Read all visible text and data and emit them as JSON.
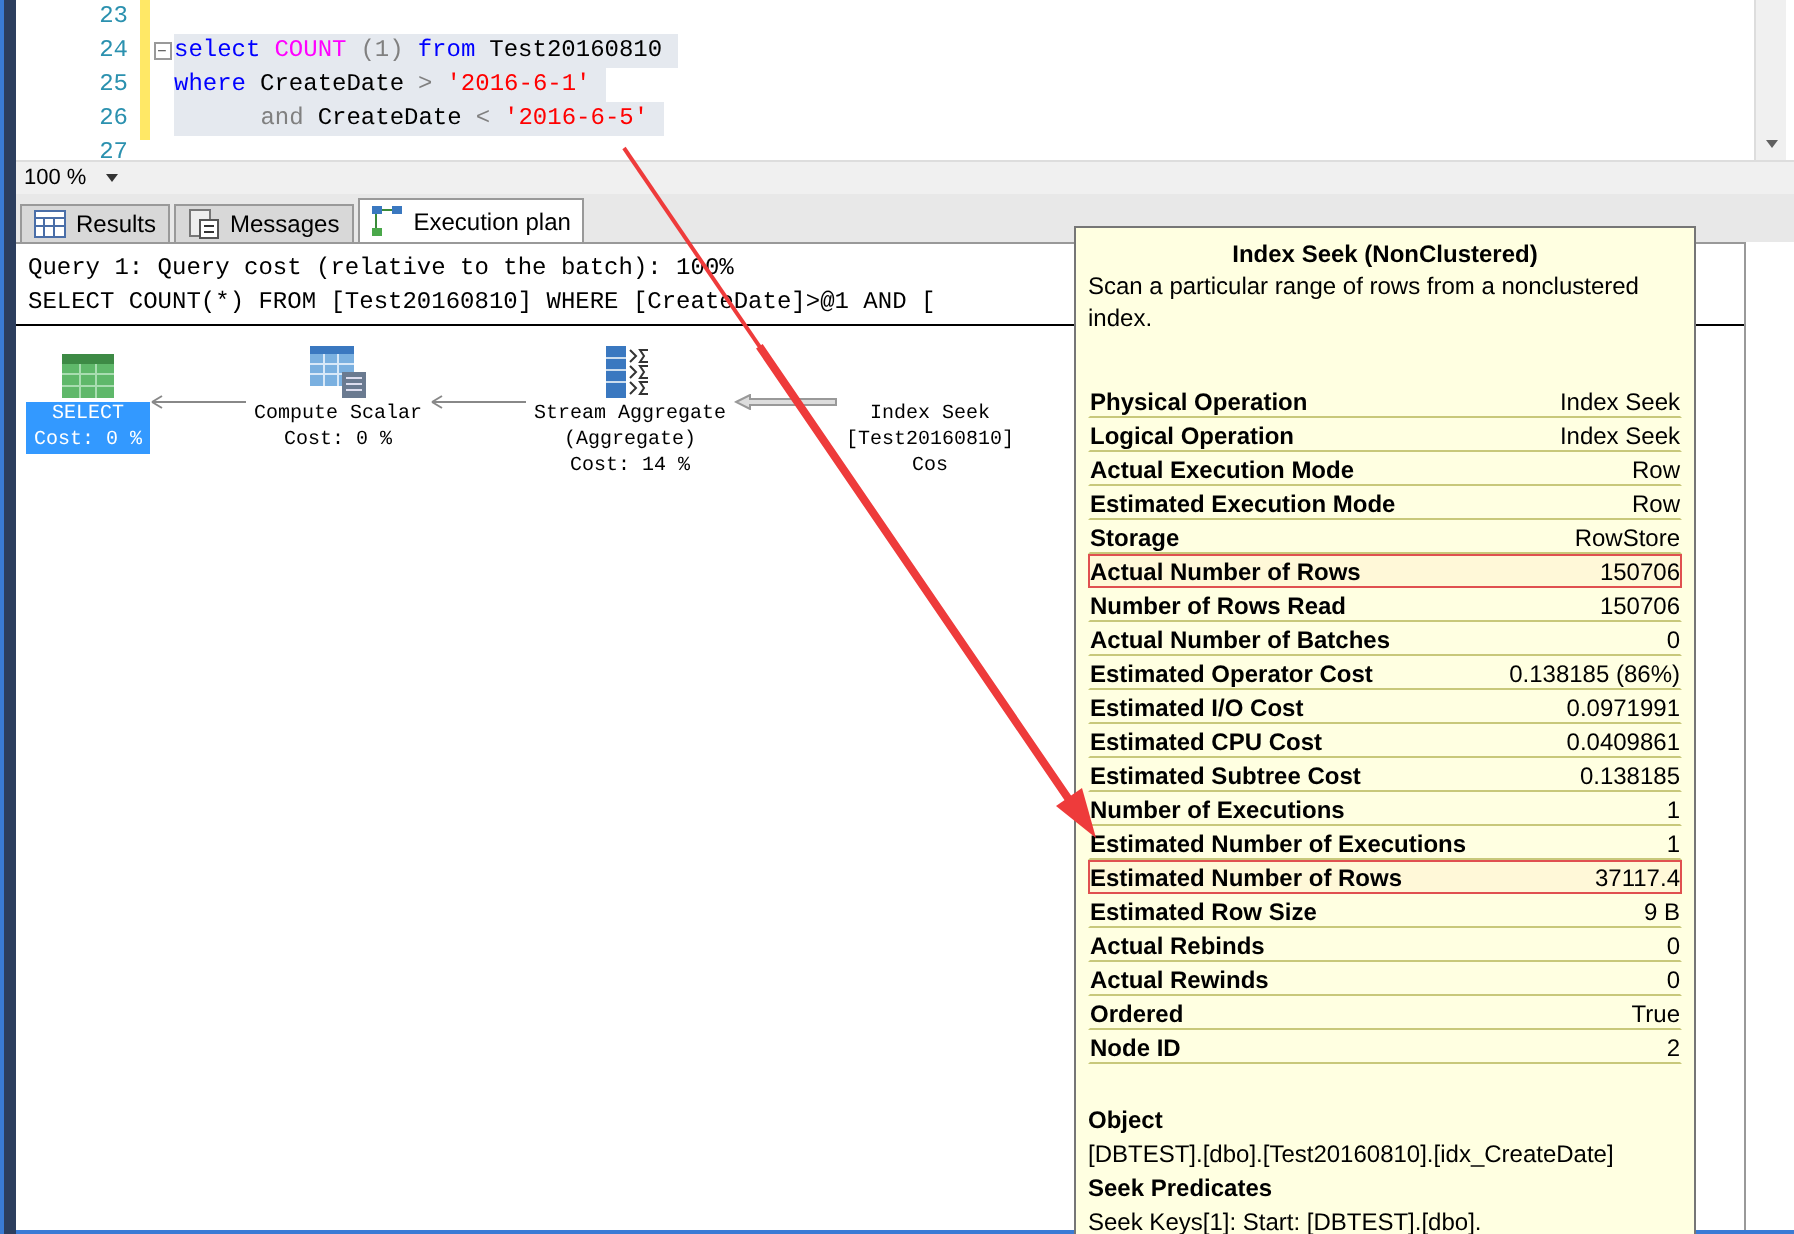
{
  "editor": {
    "lines": [
      {
        "number": "23",
        "selected": false
      },
      {
        "number": "24",
        "selected": true,
        "collapse": "−",
        "tokens": [
          {
            "kind": "keyword",
            "text": "select"
          },
          {
            "kind": "function",
            "text": "COUNT"
          },
          {
            "kind": "operator",
            "text": "(1)"
          },
          {
            "kind": "keyword",
            "text": "from"
          },
          {
            "kind": "plain",
            "text": "Test20160810"
          }
        ]
      },
      {
        "number": "25",
        "selected": true,
        "tokens": [
          {
            "kind": "keyword",
            "text": "where"
          },
          {
            "kind": "plain",
            "text": "CreateDate"
          },
          {
            "kind": "operator",
            "text": ">"
          },
          {
            "kind": "string",
            "text": "'2016-6-1'"
          }
        ]
      },
      {
        "number": "26",
        "selected": true,
        "tokens": [
          {
            "kind": "operator",
            "text": "      and"
          },
          {
            "kind": "plain",
            "text": "CreateDate"
          },
          {
            "kind": "operator",
            "text": "<"
          },
          {
            "kind": "string",
            "text": "'2016-6-5'"
          }
        ]
      },
      {
        "number": "27",
        "selected": false
      }
    ]
  },
  "zoom": {
    "value": "100 %"
  },
  "tabs": [
    {
      "label": "Results",
      "selected": false
    },
    {
      "label": "Messages",
      "selected": false
    },
    {
      "label": "Execution plan",
      "selected": true
    }
  ],
  "plan": {
    "header": [
      "Query 1: Query cost (relative to the batch): 100%",
      "SELECT COUNT(*) FROM [Test20160810] WHERE [CreateDate]>@1 AND ["
    ],
    "nodes": [
      {
        "lines": [
          "SELECT",
          "Cost: 0 %"
        ],
        "selected": true
      },
      {
        "lines": [
          "Compute Scalar",
          "Cost: 0 %"
        ],
        "selected": false
      },
      {
        "lines": [
          "Stream Aggregate",
          "(Aggregate)",
          "Cost: 14 %"
        ],
        "selected": false
      },
      {
        "lines": [
          "Index Seek",
          "[Test20160810]",
          "Cos"
        ],
        "selected": false
      }
    ]
  },
  "tooltip": {
    "title": "Index Seek (NonClustered)",
    "description": "Scan a particular range of rows from a nonclustered index.",
    "rows": [
      {
        "label": "Physical Operation",
        "value": "Index Seek",
        "highlighted": false
      },
      {
        "label": "Logical Operation",
        "value": "Index Seek",
        "highlighted": false
      },
      {
        "label": "Actual Execution Mode",
        "value": "Row",
        "highlighted": false
      },
      {
        "label": "Estimated Execution Mode",
        "value": "Row",
        "highlighted": false
      },
      {
        "label": "Storage",
        "value": "RowStore",
        "highlighted": false
      },
      {
        "label": "Actual Number of Rows",
        "value": "150706",
        "highlighted": true
      },
      {
        "label": "Number of Rows Read",
        "value": "150706",
        "highlighted": false
      },
      {
        "label": "Actual Number of Batches",
        "value": "0",
        "highlighted": false
      },
      {
        "label": "Estimated Operator Cost",
        "value": "0.138185 (86%)",
        "highlighted": false
      },
      {
        "label": "Estimated I/O Cost",
        "value": "0.0971991",
        "highlighted": false
      },
      {
        "label": "Estimated CPU Cost",
        "value": "0.0409861",
        "highlighted": false
      },
      {
        "label": "Estimated Subtree Cost",
        "value": "0.138185",
        "highlighted": false
      },
      {
        "label": "Number of Executions",
        "value": "1",
        "highlighted": false
      },
      {
        "label": "Estimated Number of Executions",
        "value": "1",
        "highlighted": false
      },
      {
        "label": "Estimated Number of Rows",
        "value": "37117.4",
        "highlighted": true
      },
      {
        "label": "Estimated Row Size",
        "value": "9 B",
        "highlighted": false
      },
      {
        "label": "Actual Rebinds",
        "value": "0",
        "highlighted": false
      },
      {
        "label": "Actual Rewinds",
        "value": "0",
        "highlighted": false
      },
      {
        "label": "Ordered",
        "value": "True",
        "highlighted": false
      },
      {
        "label": "Node ID",
        "value": "2",
        "highlighted": false
      }
    ],
    "sections": [
      {
        "heading": "Object",
        "text": "[DBTEST].[dbo].[Test20160810].[idx_CreateDate]"
      },
      {
        "heading": "Seek Predicates",
        "text": "Seek Keys[1]: Start: [DBTEST].[dbo]."
      }
    ]
  }
}
